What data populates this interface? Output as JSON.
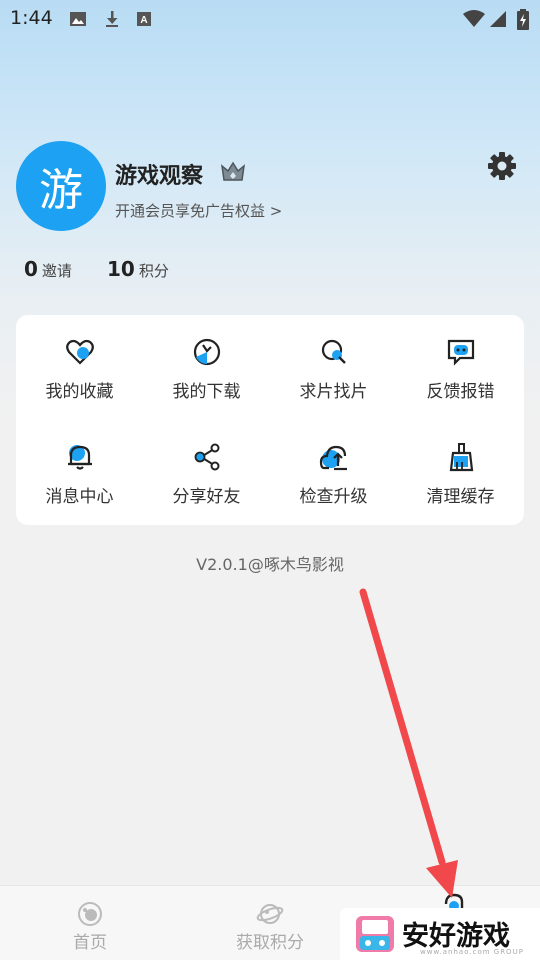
{
  "status_bar": {
    "time": "1:44"
  },
  "profile": {
    "avatar_char": "游",
    "name": "游戏观察",
    "vip_link": "开通会员享免广告权益 >"
  },
  "stats": [
    {
      "value": "0",
      "label": "邀请"
    },
    {
      "value": "10",
      "label": "积分"
    }
  ],
  "menu": [
    {
      "label": "我的收藏",
      "icon": "heart-icon"
    },
    {
      "label": "我的下载",
      "icon": "download-icon"
    },
    {
      "label": "求片找片",
      "icon": "search-icon"
    },
    {
      "label": "反馈报错",
      "icon": "feedback-icon"
    },
    {
      "label": "消息中心",
      "icon": "bell-icon"
    },
    {
      "label": "分享好友",
      "icon": "share-icon"
    },
    {
      "label": "检查升级",
      "icon": "upgrade-icon"
    },
    {
      "label": "清理缓存",
      "icon": "broom-icon"
    }
  ],
  "version": "V2.0.1@啄木鸟影视",
  "nav": [
    {
      "label": "首页",
      "icon": "home-icon"
    },
    {
      "label": "获取积分",
      "icon": "planet-icon"
    },
    {
      "label": "",
      "icon": "profile-icon"
    }
  ],
  "watermark": {
    "text": "安好游戏",
    "sub": "www.anhao.com GROUP"
  },
  "colors": {
    "accent": "#1da1f2",
    "arrow": "#f0484b"
  }
}
